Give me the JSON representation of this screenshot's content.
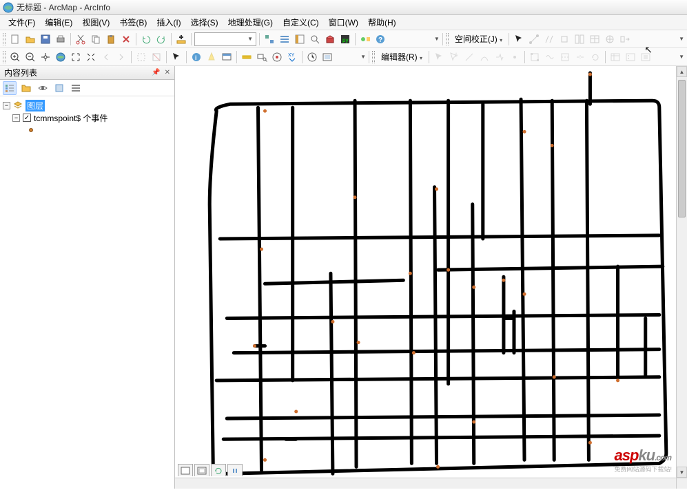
{
  "titlebar": {
    "text": "无标题 - ArcMap - ArcInfo"
  },
  "menus": {
    "file": "文件(F)",
    "edit": "编辑(E)",
    "view": "视图(V)",
    "bookmarks": "书签(B)",
    "insert": "插入(I)",
    "selection": "选择(S)",
    "geoprocessing": "地理处理(G)",
    "customize": "自定义(C)",
    "window": "窗口(W)",
    "help": "帮助(H)"
  },
  "toolbar": {
    "scale": "",
    "spatial_adjust": "空间校正(J)",
    "editor": "编辑器(R)"
  },
  "toc": {
    "title": "内容列表",
    "root": "图层",
    "layer1": "tcmmspoint$ 个事件"
  },
  "watermark": {
    "brand_a": "asp",
    "brand_b": "ku",
    "suffix": ".com",
    "sub": "免费网站源码下载站!"
  }
}
